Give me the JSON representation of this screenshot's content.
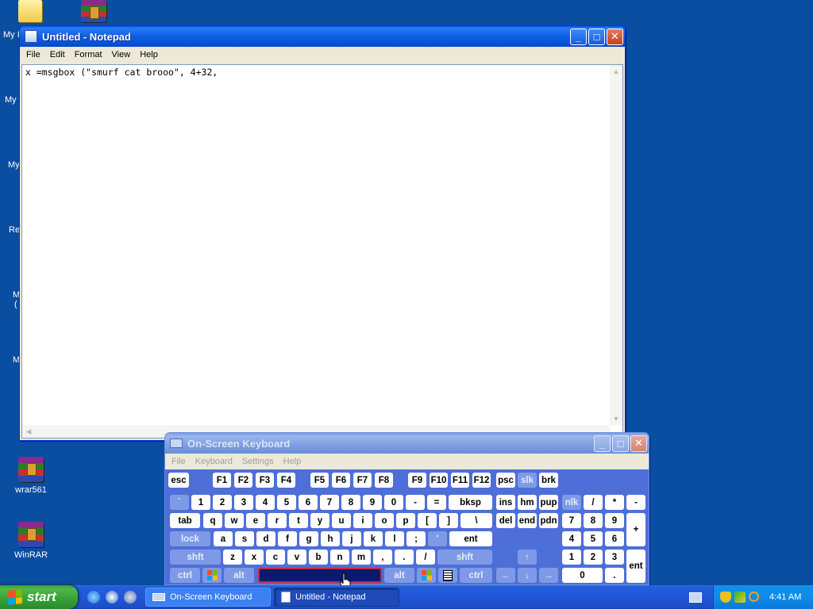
{
  "desktop": {
    "icons": [
      {
        "label": "wrar561"
      },
      {
        "label": "WinRAR"
      }
    ],
    "cut_labels": [
      "My I",
      "My",
      "My",
      "Re",
      "M",
      "(",
      "M"
    ]
  },
  "notepad": {
    "title": "Untitled - Notepad",
    "menu": [
      "File",
      "Edit",
      "Format",
      "View",
      "Help"
    ],
    "content": "x =msgbox (\"smurf cat brooo\", 4+32,"
  },
  "osk": {
    "title": "On-Screen Keyboard",
    "menu": [
      "File",
      "Keyboard",
      "Settings",
      "Help"
    ],
    "keys": {
      "esc": "esc",
      "f": [
        "F1",
        "F2",
        "F3",
        "F4",
        "F5",
        "F6",
        "F7",
        "F8",
        "F9",
        "F10",
        "F11",
        "F12"
      ],
      "psc": "psc",
      "slk": "slk",
      "brk": "brk",
      "num_row": [
        "`",
        "1",
        "2",
        "3",
        "4",
        "5",
        "6",
        "7",
        "8",
        "9",
        "0",
        "-",
        "="
      ],
      "bksp": "bksp",
      "tab": "tab",
      "q_row": [
        "q",
        "w",
        "e",
        "r",
        "t",
        "y",
        "u",
        "i",
        "o",
        "p",
        "[",
        "]",
        "\\"
      ],
      "lock": "lock",
      "a_row": [
        "a",
        "s",
        "d",
        "f",
        "g",
        "h",
        "j",
        "k",
        "l",
        ";",
        "'"
      ],
      "ent": "ent",
      "shft": "shft",
      "z_row": [
        "z",
        "x",
        "c",
        "v",
        "b",
        "n",
        "m",
        ",",
        ".",
        "/"
      ],
      "ctrl": "ctrl",
      "alt": "alt",
      "nav": [
        "ins",
        "hm",
        "pup",
        "del",
        "end",
        "pdn"
      ],
      "arrows": [
        "↑",
        "←",
        "↓",
        "→"
      ],
      "numpad": {
        "nlk": "nlk",
        "div": "/",
        "mul": "*",
        "sub": "-",
        "row7": [
          "7",
          "8",
          "9"
        ],
        "add": "+",
        "row4": [
          "4",
          "5",
          "6"
        ],
        "row1": [
          "1",
          "2",
          "3"
        ],
        "zero": "0",
        "dot": ".",
        "ent": "ent"
      }
    }
  },
  "taskbar": {
    "start_label": "start",
    "tasks": [
      {
        "label": "On-Screen Keyboard"
      },
      {
        "label": "Untitled - Notepad"
      }
    ],
    "clock": "4:41 AM"
  },
  "colors": {
    "desktop": "#0A4EA2",
    "xp_blue": "#0A58EE",
    "key_mod": "#7E9AE6"
  }
}
